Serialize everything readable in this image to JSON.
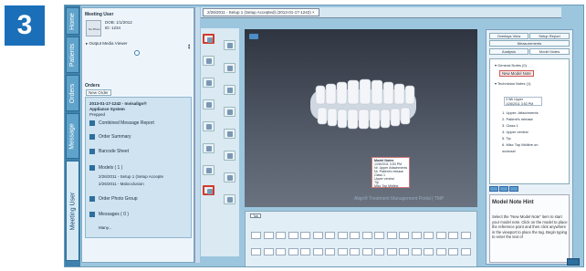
{
  "step": {
    "number": "3"
  },
  "window": {
    "tab_title": "2/26/2011 - Setup 1 (Setup Accepted) (2013-01-17-1242)"
  },
  "vertical_tabs": [
    "Home",
    "Patients",
    "Orders",
    "Message",
    "Meeting User"
  ],
  "patient": {
    "name": "Meeting User",
    "dob": "DOB: 1/1/2012",
    "id": "ID: 1234",
    "no_photo": "No Photo",
    "option": "Output Media Viewer"
  },
  "orders": {
    "heading": "Orders",
    "new_order": "New Order",
    "order_date": "2013-01-17-1242 - Invisalign®",
    "order_type": "Appliance System",
    "order_status": "Prepped",
    "items": [
      {
        "label": "Combined Message Report"
      },
      {
        "label": "Order Summary"
      },
      {
        "label": "Barcode Sheet"
      },
      {
        "label": "Models ( 1 )",
        "subs": [
          "2/26/2011 - Setup 1 (Setup Accepte",
          "2/26/2011 - Malocclusion"
        ]
      },
      {
        "label": "Order Photo Group"
      },
      {
        "label": "Messages ( 0 )"
      },
      {
        "label": "Many..."
      }
    ]
  },
  "viewer": {
    "watermark": "Align® Treatment Management Portal | TMP"
  },
  "popup": {
    "lines": [
      "Model Notes",
      "1/26/2011 3:53 PM",
      "Nr. Upper Attachments",
      "Nr. Patient's release",
      "Class 1",
      "Upper ventral",
      "Tip",
      "Misc Top Midline",
      "Discuss"
    ]
  },
  "chart": {
    "tab_label": "Tab"
  },
  "right_panel": {
    "tabs_top": [
      "Overlays View",
      "Setup Report"
    ],
    "measurements": "Measurements",
    "tabs_bottom": [
      "Analysis",
      "Model Notes"
    ],
    "notes": {
      "general": "General Notes (0)",
      "new_button": "New Model Note",
      "technician": "Technician Notes (1)",
      "note_box": [
        "3 Wk Upper",
        "1/26/2011 3:53 PM"
      ],
      "lines": [
        "1. Upper: Attachments",
        "2. Patient's release",
        "3. Class 1",
        "4. Upper ventral",
        "5. Tip",
        "6. Misc Top Midline on",
        "   occlusal"
      ]
    },
    "hint": {
      "title": "Model Note Hint",
      "body": "Select the \"New Model Note\" item to start your model note. Click on the model to place the reference point and then click anywhere in the viewport to place the tag. Begin typing to enter the text of"
    }
  }
}
